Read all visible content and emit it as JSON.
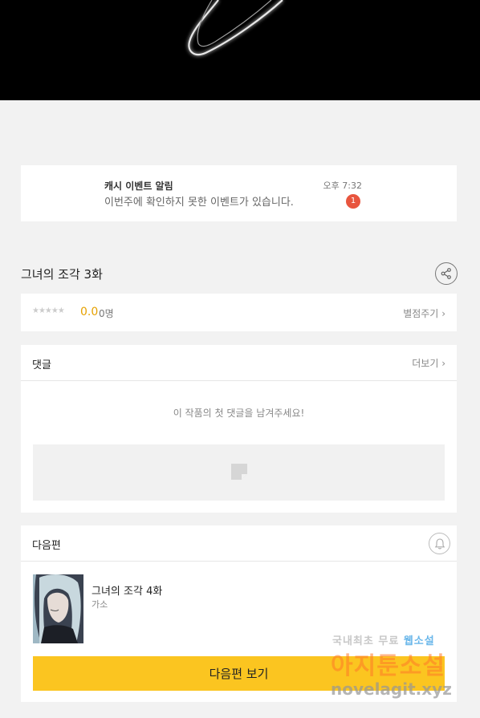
{
  "notice": {
    "title": "캐시 이벤트 알림",
    "body": "이번주에 확인하지 못한 이벤트가 있습니다.",
    "time": "오후 7:32",
    "badge": "1"
  },
  "episode": {
    "title": "그녀의 조각 3화",
    "share_icon": "share-icon"
  },
  "rating": {
    "stars": "★★★★★",
    "score": "0.0",
    "people": "0명",
    "rate_link": "별점주기"
  },
  "comments": {
    "header": "댓글",
    "more_link": "더보기",
    "empty_message": "이 작품의 첫 댓글을 남겨주세요!",
    "input_icon": "note-icon"
  },
  "next_episode": {
    "header": "다음편",
    "bell_icon": "bell-icon",
    "title": "그녀의 조각 4화",
    "author": "가소",
    "button_label": "다음편 보기"
  },
  "watermark": {
    "line1_a": "국내최초 무료",
    "line1_b": "웹소설",
    "line2": "아지툰소설",
    "line3": "novelagit.xyz"
  },
  "colors": {
    "accent": "#fbc520",
    "badge": "#e8553e",
    "score": "#e6a100",
    "background": "#f2f2f2"
  }
}
